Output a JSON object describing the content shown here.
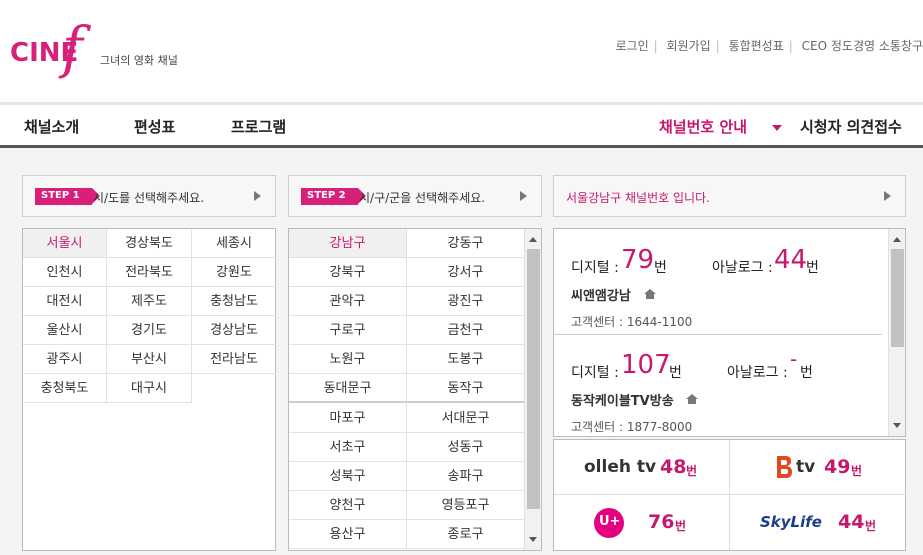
{
  "header": {
    "logo_text": "CINE",
    "logo_f": "f",
    "logo_tagline": "그녀의 영화 채널",
    "top_links": [
      "로그인",
      "회원가입",
      "통합편성표",
      "CEO 정도경영 소통창구"
    ]
  },
  "nav": {
    "items": [
      "채널소개",
      "편성표",
      "프로그램"
    ],
    "channel_guide": "채널번호 안내",
    "feedback": "시청자 의견접수"
  },
  "step1": {
    "label": "STEP 1",
    "text": "시/도를 선택해주세요."
  },
  "step2": {
    "label": "STEP 2",
    "text": "시/구/군을 선택해주세요."
  },
  "result_title": "서울강남구 채널번호 입니다.",
  "regions": [
    "서울시",
    "경상북도",
    "세종시",
    "인천시",
    "전라북도",
    "강원도",
    "대전시",
    "제주도",
    "충청남도",
    "울산시",
    "경기도",
    "경상남도",
    "광주시",
    "부산시",
    "전라남도",
    "충청북도",
    "대구시"
  ],
  "selected_region": "서울시",
  "districts": [
    "강남구",
    "강동구",
    "강북구",
    "강서구",
    "관악구",
    "광진구",
    "구로구",
    "금천구",
    "노원구",
    "도봉구",
    "동대문구",
    "동작구",
    "마포구",
    "서대문구",
    "서초구",
    "성동구",
    "성북구",
    "송파구",
    "양천구",
    "영등포구",
    "용산구",
    "종로구"
  ],
  "selected_district": "강남구",
  "operators": [
    {
      "digital_label": "디지털 :",
      "digital": "79",
      "unit": "번",
      "analog_label": "아날로그 :",
      "analog": "44",
      "name": "씨앤앰강남",
      "cs": "고객센터 : 1644-1100"
    },
    {
      "digital_label": "디지털 :",
      "digital": "107",
      "unit": "번",
      "analog_label": "아날로그 :",
      "analog": "-",
      "name": "동작케이블TV방송",
      "cs": "고객센터 : 1877-8000"
    }
  ],
  "providers": [
    {
      "name": "olleh tv",
      "num": "48",
      "unit": "번"
    },
    {
      "name": "tv",
      "num": "49",
      "unit": "번"
    },
    {
      "name": "U+",
      "num": "76",
      "unit": "번"
    },
    {
      "name": "SkyLife",
      "num": "44",
      "unit": "번"
    }
  ],
  "colors": {
    "accent": "#d6207a",
    "nav_dark": "#555555"
  }
}
